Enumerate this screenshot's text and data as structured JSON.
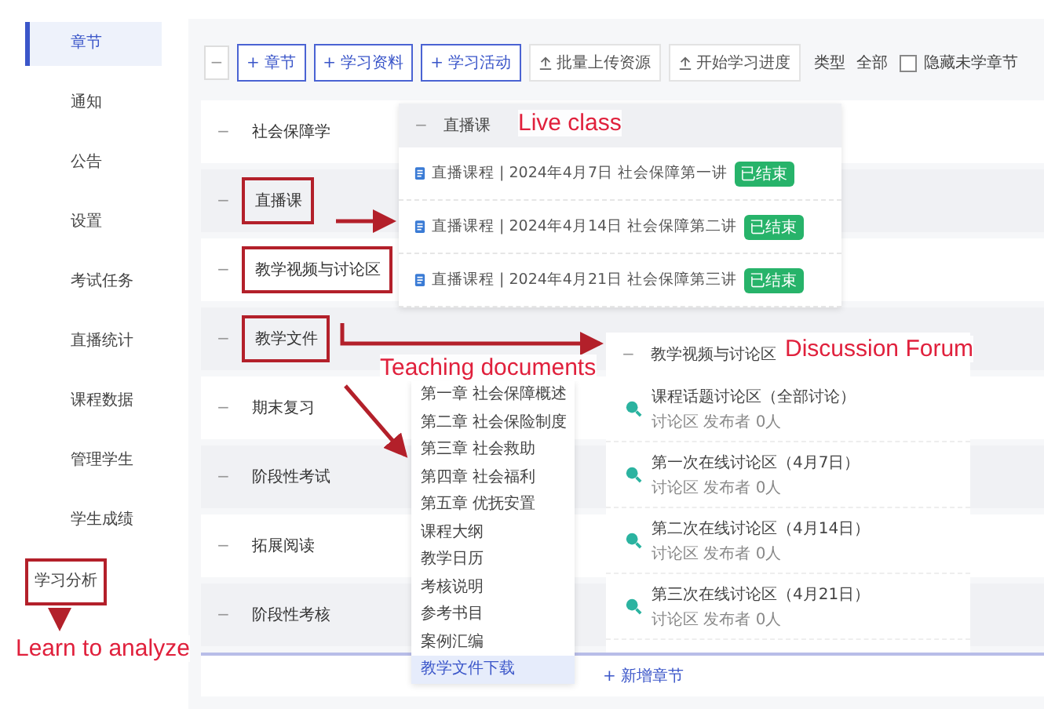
{
  "sidebar": {
    "items": [
      {
        "label": "章节",
        "selected": true,
        "annotated": false
      },
      {
        "label": "通知",
        "selected": false,
        "annotated": false
      },
      {
        "label": "公告",
        "selected": false,
        "annotated": false
      },
      {
        "label": "设置",
        "selected": false,
        "annotated": false
      },
      {
        "label": "考试任务",
        "selected": false,
        "annotated": false
      },
      {
        "label": "直播统计",
        "selected": false,
        "annotated": false
      },
      {
        "label": "课程数据",
        "selected": false,
        "annotated": false
      },
      {
        "label": "管理学生",
        "selected": false,
        "annotated": false
      },
      {
        "label": "学生成绩",
        "selected": false,
        "annotated": false
      },
      {
        "label": "学习分析",
        "selected": false,
        "annotated": true
      }
    ]
  },
  "toolbar": {
    "collapse": "−",
    "buttons": [
      {
        "label": "+ 章节",
        "kind": "outline"
      },
      {
        "label": "+ 学习资料",
        "kind": "outline"
      },
      {
        "label": "+ 学习活动",
        "kind": "outline"
      },
      {
        "label": "批量上传资源",
        "kind": "plain"
      },
      {
        "label": "开始学习进度",
        "kind": "plain"
      }
    ],
    "filter_label": "类型",
    "filter_value": "全部",
    "checkbox": {
      "label": "隐藏未学章节",
      "checked": false
    }
  },
  "chapters": [
    {
      "caret": "−",
      "title": "社会保障学",
      "annotated": false
    },
    {
      "caret": "−",
      "title": "直播课",
      "annotated": true
    },
    {
      "caret": "−",
      "title": "教学视频与讨论区",
      "annotated": true
    },
    {
      "caret": "−",
      "title": "教学文件",
      "annotated": true
    },
    {
      "caret": "−",
      "title": "期末复习",
      "annotated": false
    },
    {
      "caret": "−",
      "title": "阶段性考试",
      "annotated": false
    },
    {
      "caret": "−",
      "title": "拓展阅读",
      "annotated": false
    },
    {
      "caret": "−",
      "title": "阶段性考核",
      "annotated": false
    }
  ],
  "add_chapter": "+ 新增章节",
  "live_popup": {
    "caret": "−",
    "header": "直播课",
    "items": [
      {
        "text": "直播课程 | 2024年4月7日 社会保障第一讲",
        "tag": "已结束"
      },
      {
        "text": "直播课程 | 2024年4月14日 社会保障第二讲",
        "tag": "已结束"
      },
      {
        "text": "直播课程 | 2024年4月21日 社会保障第三讲",
        "tag": "已结束"
      }
    ]
  },
  "forum_popup": {
    "caret": "−",
    "header": "教学视频与讨论区",
    "items": [
      {
        "title": "课程话题讨论区（全部讨论）",
        "meta": "讨论区 发布者 0人"
      },
      {
        "title": "第一次在线讨论区（4月7日）",
        "meta": "讨论区 发布者 0人"
      },
      {
        "title": "第二次在线讨论区（4月14日）",
        "meta": "讨论区 发布者 0人"
      },
      {
        "title": "第三次在线讨论区（4月21日）",
        "meta": "讨论区 发布者 0人"
      }
    ]
  },
  "doc_list": {
    "items": [
      {
        "label": "第一章 社会保障概述",
        "selected": false
      },
      {
        "label": "第二章 社会保险制度",
        "selected": false
      },
      {
        "label": "第三章 社会救助",
        "selected": false
      },
      {
        "label": "第四章 社会福利",
        "selected": false
      },
      {
        "label": "第五章 优抚安置",
        "selected": false
      },
      {
        "label": "课程大纲",
        "selected": false
      },
      {
        "label": "教学日历",
        "selected": false
      },
      {
        "label": "考核说明",
        "selected": false
      },
      {
        "label": "参考书目",
        "selected": false
      },
      {
        "label": "案例汇编",
        "selected": false
      },
      {
        "label": "教学文件下载",
        "selected": true
      }
    ]
  },
  "annotations": [
    {
      "kind": "live",
      "text": "Live class"
    },
    {
      "kind": "forum",
      "text": "Discussion Forum"
    },
    {
      "kind": "docs",
      "text": "Teaching documents"
    },
    {
      "kind": "analyze",
      "text": "Learn to analyze"
    }
  ]
}
